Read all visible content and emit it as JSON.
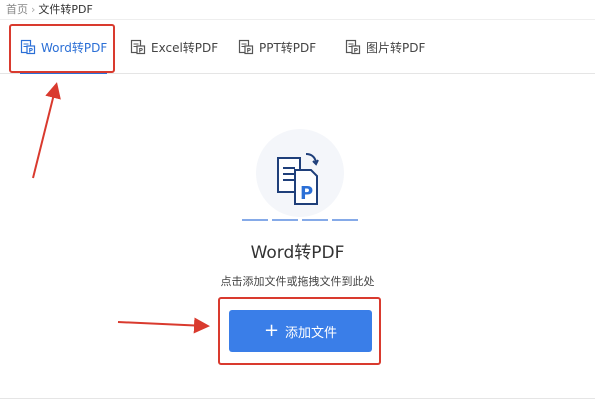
{
  "breadcrumb": {
    "home": "首页",
    "separator": "›",
    "current": "文件转PDF"
  },
  "tabs": [
    {
      "label": "Word转PDF",
      "icon": "word-doc-icon"
    },
    {
      "label": "Excel转PDF",
      "icon": "excel-doc-icon"
    },
    {
      "label": "PPT转PDF",
      "icon": "ppt-doc-icon"
    },
    {
      "label": "图片转PDF",
      "icon": "image-doc-icon"
    }
  ],
  "main": {
    "title": "Word转PDF",
    "hint": "点击添加文件或拖拽文件到此处",
    "add_plus": "+",
    "add_label": "添加文件"
  },
  "colors": {
    "accent": "#2b6fd6",
    "button": "#3a7ee8",
    "highlight": "#d93a2e"
  }
}
